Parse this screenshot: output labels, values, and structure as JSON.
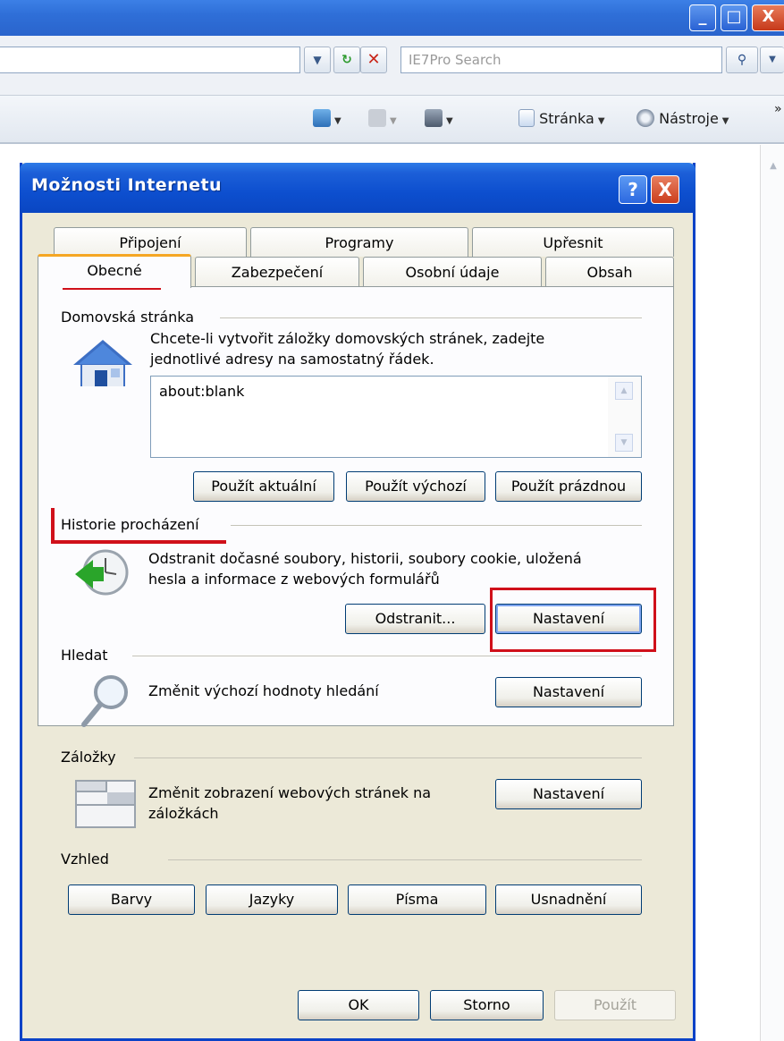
{
  "browser": {
    "search_placeholder": "IE7Pro Search",
    "commands": {
      "page": "Stránka",
      "tools": "Nástroje"
    },
    "window_buttons": {
      "minimize": "_",
      "maximize": "□",
      "close": "X"
    }
  },
  "dialog": {
    "title": "Možnosti Internetu",
    "help": "?",
    "close": "X",
    "tabs_row1": [
      "Připojení",
      "Programy",
      "Upřesnit"
    ],
    "tabs_row2": [
      "Obecné",
      "Zabezpečení",
      "Osobní údaje",
      "Obsah"
    ],
    "active_tab": "Obecné",
    "homepage": {
      "label": "Domovská stránka",
      "desc_line1": "Chcete-li vytvořit záložky domovských stránek, zadejte",
      "desc_line2": "jednotlivé adresy na samostatný řádek.",
      "value": "about:blank",
      "btn_current": "Použít aktuální",
      "btn_default": "Použít výchozí",
      "btn_blank": "Použít prázdnou"
    },
    "history": {
      "label": "Historie procházení",
      "desc_line1": "Odstranit dočasné soubory, historii, soubory cookie, uložená",
      "desc_line2": "hesla a informace z webových formulářů",
      "btn_delete": "Odstranit...",
      "btn_settings": "Nastavení"
    },
    "search": {
      "label": "Hledat",
      "desc": "Změnit výchozí hodnoty hledání",
      "btn_settings": "Nastavení"
    },
    "tabs_section": {
      "label": "Záložky",
      "desc_line1": "Změnit zobrazení webových stránek na",
      "desc_line2": "záložkách",
      "btn_settings": "Nastavení"
    },
    "appearance": {
      "label": "Vzhled",
      "btn_colors": "Barvy",
      "btn_languages": "Jazyky",
      "btn_fonts": "Písma",
      "btn_accessibility": "Usnadnění"
    },
    "footer": {
      "ok": "OK",
      "cancel": "Storno",
      "apply": "Použít"
    }
  },
  "colors": {
    "annotation_red": "#d0101a",
    "xp_blue": "#0a46c2",
    "dialog_bg": "#ece9d8"
  }
}
